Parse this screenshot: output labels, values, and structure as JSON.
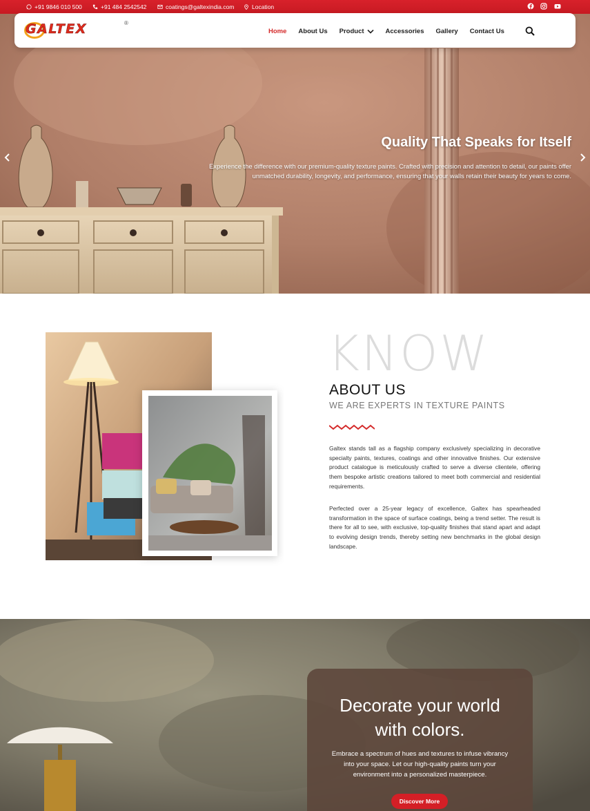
{
  "topbar": {
    "whatsapp": "+91 9846 010 500",
    "phone": "+91 484 2542542",
    "email": "coatings@galtexindia.com",
    "location": "Location"
  },
  "nav": {
    "logo": "GALTEX",
    "logo_reg": "®",
    "items": [
      "Home",
      "About Us",
      "Product",
      "Accessories",
      "Gallery",
      "Contact Us"
    ]
  },
  "hero": {
    "title": "Quality That Speaks for Itself",
    "text": "Experience the difference with our premium-quality texture paints. Crafted with precision and attention to detail, our paints offer unmatched durability, longevity, and performance, ensuring that your walls retain their beauty for years to come."
  },
  "about": {
    "watermark": "KNOW",
    "title": "ABOUT US",
    "subtitle": "WE ARE EXPERTS IN TEXTURE PAINTS",
    "paragraph1": "Galtex stands tall as a flagship company exclusively specializing in decorative specialty paints, textures, coatings and other innovative finishes.  Our extensive product catalogue is meticulously crafted to serve a diverse clientele, offering them bespoke artistic creations tailored to meet both commercial and residential requirements.",
    "paragraph2": "Perfected over a 25-year legacy of excellence, Galtex has spearheaded transformation in the space of  surface coatings, being a trend setter. The result is there for all to see, with exclusive, top-quality finishes that stand apart and adapt to evolving design trends, thereby setting new benchmarks in the global design landscape."
  },
  "decorate": {
    "title_line1": "Decorate your world",
    "title_line2": "with colors.",
    "text": "Embrace a spectrum of hues and textures to infuse vibrancy into your space. Let our high-quality paints turn your environment into a personalized masterpiece.",
    "button": "Discover More"
  },
  "colors": {
    "brand_red": "#d41f26",
    "logo_orange": "#f3a21b"
  },
  "icons": [
    "whatsapp-icon",
    "phone-icon",
    "email-icon",
    "location-icon",
    "facebook-icon",
    "instagram-icon",
    "youtube-icon",
    "search-icon",
    "chevron-down-icon",
    "arrow-left-icon",
    "arrow-right-icon"
  ]
}
